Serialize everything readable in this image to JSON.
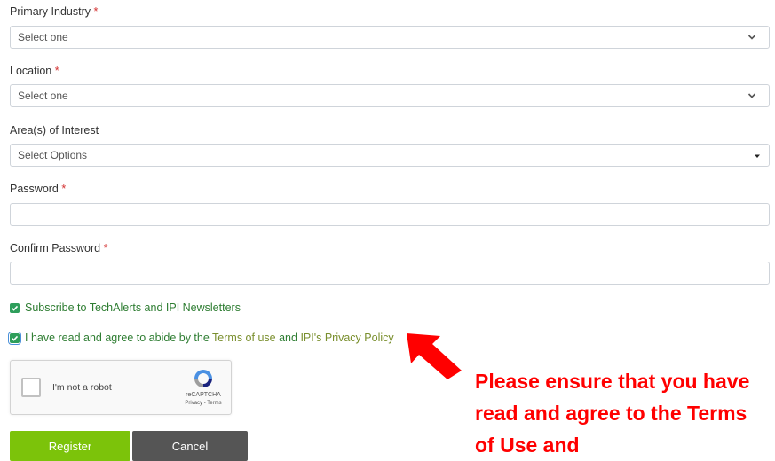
{
  "fields": {
    "primary_industry": {
      "label": "Primary Industry",
      "required_mark": "*",
      "value": "Select one"
    },
    "location": {
      "label": "Location",
      "required_mark": "*",
      "value": "Select one"
    },
    "areas_of_interest": {
      "label": "Area(s) of Interest",
      "value": "Select Options"
    },
    "password": {
      "label": "Password",
      "required_mark": "*",
      "value": ""
    },
    "confirm_password": {
      "label": "Confirm Password",
      "required_mark": "*",
      "value": ""
    }
  },
  "checkboxes": {
    "subscribe": {
      "label": "Subscribe to TechAlerts and IPI Newsletters",
      "checked": true
    },
    "agree": {
      "prefix": "I have read and agree to abide by the",
      "terms_link": "Terms of use",
      "conjunction": "and",
      "privacy_link": "IPI's Privacy Policy",
      "checked": true
    }
  },
  "recaptcha": {
    "label": "I'm not a robot",
    "brand": "reCAPTCHA",
    "terms": "Privacy - Terms"
  },
  "buttons": {
    "register": "Register",
    "cancel": "Cancel"
  },
  "annotation": {
    "text": "Please ensure that you have read and agree to the Terms of Use and",
    "color": "#ff0000"
  },
  "colors": {
    "required": "#d32f2f",
    "checkbox": "#2e9e5b",
    "register_button": "#7cc30a",
    "cancel_button": "#555555",
    "arrow": "#ff0000"
  },
  "icons": {
    "select_arrow": "chevron-down-icon",
    "multiselect_arrow": "caret-down-icon",
    "checkbox": "check-icon",
    "annotation": "arrow-icon"
  }
}
